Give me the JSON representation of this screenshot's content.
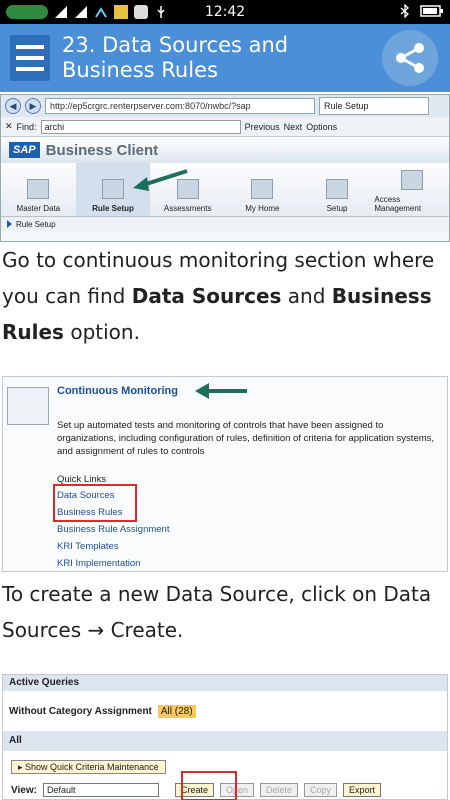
{
  "statusbar": {
    "time": "12:42"
  },
  "appbar": {
    "title": "23. Data Sources and Business Rules"
  },
  "shot1": {
    "url": "http://ep5crgrc.renterpserver.com:8070/nwbc/?sap",
    "tab_label": "Rule Setup",
    "find_label": "Find:",
    "find_value": "archi",
    "previous": "Previous",
    "next": "Next",
    "options": "Options",
    "brand": "SAP",
    "app_name": "Business Client",
    "tiles": [
      "Master Data",
      "Rule Setup",
      "Assessments",
      "My Home",
      "Setup",
      "Access Management"
    ],
    "crumb": "Rule Setup"
  },
  "para1": {
    "pre": "Go to continuous monitoring section where you can find ",
    "b1": "Data Sources",
    "mid": " and ",
    "b2": "Business Rules",
    "post": " option."
  },
  "shot2": {
    "title": "Continuous Monitoring",
    "description": "Set up automated tests and monitoring of controls that have been assigned to organizations, including configuration of rules, definition of criteria for application systems, and assignment of rules to controls",
    "quick_links_title": "Quick Links",
    "links": [
      "Data Sources",
      "Business Rules",
      "Business Rule Assignment",
      "KRI Templates",
      "KRI Implementation"
    ]
  },
  "para2": {
    "text": "To create a new Data Source, click on Data Sources → Create."
  },
  "shot3": {
    "active_queries": "Active Queries",
    "without_category": "Without Category Assignment",
    "all_count": "All (28)",
    "all_header": "All",
    "quick_criteria": "Show Quick Criteria Maintenance",
    "view_label": "View:",
    "view_value": "Default",
    "buttons": [
      "Create",
      "Open",
      "Delete",
      "Copy",
      "Export"
    ]
  }
}
